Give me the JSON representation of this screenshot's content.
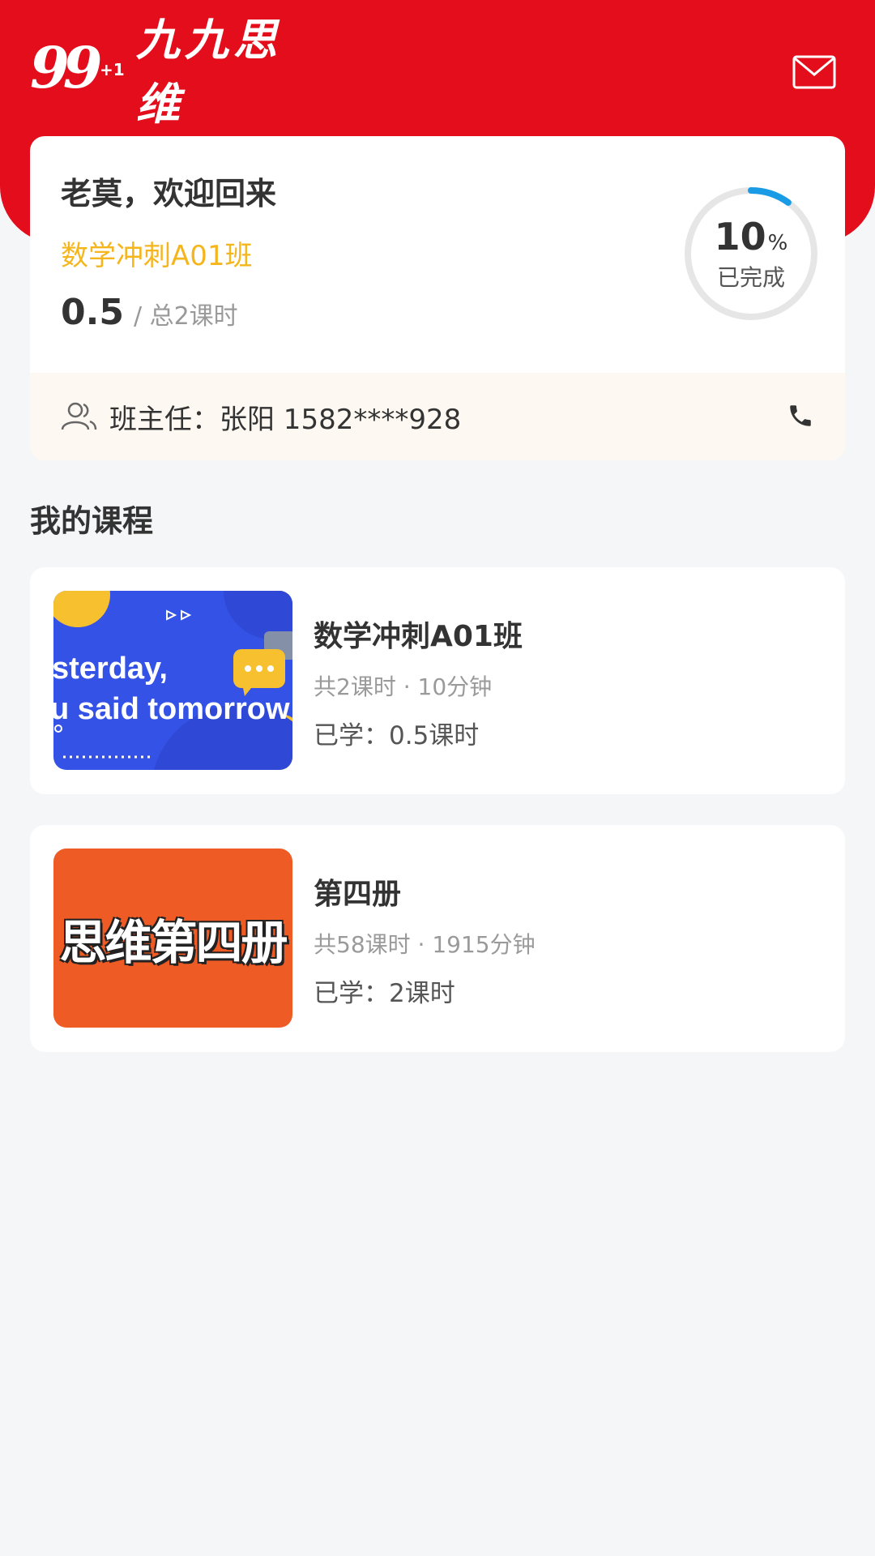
{
  "header": {
    "logo_number": "99",
    "logo_superscript": "+1",
    "logo_text": "九九思维",
    "mail_icon": "mail-icon",
    "brand_color": "#e30d1b"
  },
  "summary": {
    "greeting": "老莫，欢迎回来",
    "class_name": "数学冲刺A01班",
    "hours_done": "0.5",
    "hours_total": "/ 总2课时",
    "progress_value": "10",
    "progress_fraction": 0.1,
    "progress_sign": "%",
    "progress_label": "已完成",
    "teacher_text": "班主任：张阳 1582****928",
    "accent_color": "#f5b51d",
    "ring_color": "#1a9be6"
  },
  "courses_section": {
    "title": "我的课程"
  },
  "courses": [
    {
      "title": "数学冲刺A01班",
      "meta": "共2课时 ·  10分钟",
      "learned": "已学：0.5课时",
      "thumb_lines": [
        "sterday,",
        "u said tomorrow"
      ]
    },
    {
      "title": "第四册",
      "meta": "共58课时 ·  1915分钟",
      "learned": "已学：2课时",
      "thumb_text": "思维第四册"
    }
  ]
}
